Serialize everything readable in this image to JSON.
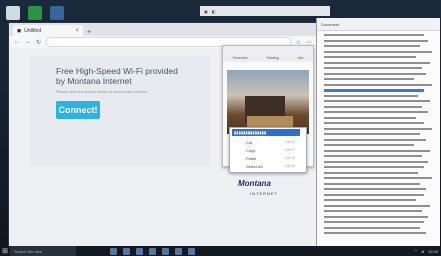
{
  "browser": {
    "tab_label": "Untitled",
    "url_placeholder": "..."
  },
  "page": {
    "title_line1": "Free High-Speed Wi-Fi provided",
    "title_line2": "by Montana Internet",
    "subtitle": "Please click the button below to access the internet.",
    "connect_label": "Connect!",
    "logo_text": "Montana",
    "logo_sub": "INTERNET"
  },
  "viewer": {
    "tabs": [
      "Overview",
      "Sharing",
      "Info"
    ]
  },
  "context_menu": {
    "items": [
      {
        "label": "Cut",
        "shortcut": "Ctrl+X"
      },
      {
        "label": "Copy",
        "shortcut": "Ctrl+C"
      },
      {
        "label": "Paste",
        "shortcut": "Ctrl+V"
      },
      {
        "label": "Select All",
        "shortcut": "Ctrl+A"
      }
    ]
  },
  "document": {
    "title": "Document"
  },
  "taskbar": {
    "search_placeholder": "Search the web",
    "time": "12:00"
  }
}
